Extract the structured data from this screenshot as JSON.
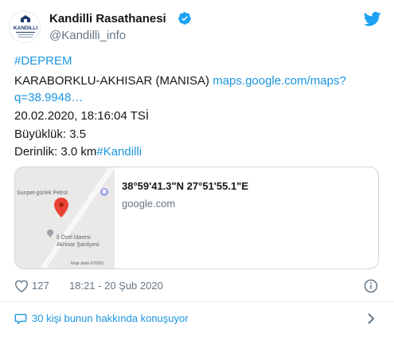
{
  "header": {
    "display_name": "Kandilli Rasathanesi",
    "handle": "@Kandilli_info",
    "avatar_text": "KANDILLI"
  },
  "body": {
    "hashtag": "#DEPREM",
    "location": "KARABORKLU-AKHISAR (MANISA)",
    "link_part1": "maps.google.com/maps?",
    "link_part2": "q=38.9948…",
    "datetime": "20.02.2020, 18:16:04 TSİ",
    "magnitude": "Büyüklük: 3.5",
    "depth": "Derinlik: 3.0 km",
    "hashtag2": "#Kandilli"
  },
  "card": {
    "title": "38°59'41.3\"N 27°51'55.1\"E",
    "domain": "google.com",
    "map_label_1": "Sunpet-gürlek Petrol",
    "map_label_2": "İl Özel İdaresi",
    "map_label_3": "Akhisar Şantiyesi",
    "map_data": "Map data ©2020"
  },
  "meta": {
    "likes": "127",
    "timestamp": "18:21 - 20 Şub 2020"
  },
  "footer": {
    "conversation": "30 kişi bunun hakkında konuşuyor"
  },
  "colors": {
    "link": "#1b95e0",
    "verified": "#1da1f2",
    "secondary_text": "#657786"
  }
}
